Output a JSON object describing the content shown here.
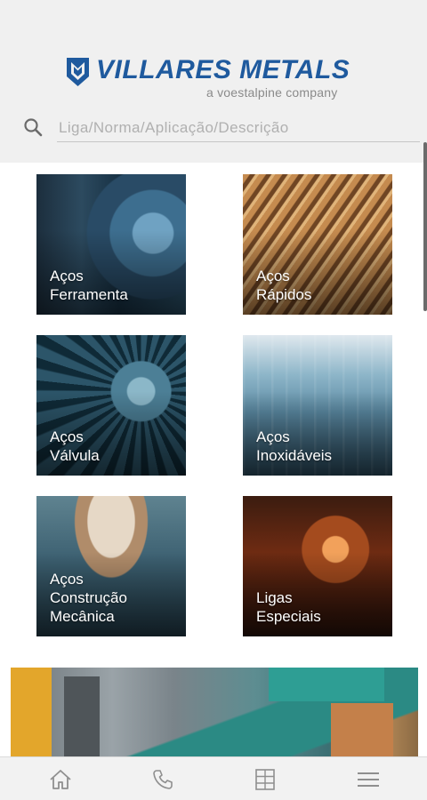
{
  "brand": {
    "name": "VILLARES METALS",
    "tagline": "a voestalpine company",
    "color": "#1f5a9e"
  },
  "search": {
    "placeholder": "Liga/Norma/Aplicação/Descrição",
    "value": "",
    "icon": "search-icon"
  },
  "categories": [
    {
      "id": "acos-ferramenta",
      "lines": [
        "Aços",
        "Ferramenta"
      ]
    },
    {
      "id": "acos-rapidos",
      "lines": [
        "Aços",
        "Rápidos"
      ]
    },
    {
      "id": "acos-valvula",
      "lines": [
        "Aços",
        "Válvula"
      ]
    },
    {
      "id": "acos-inoxidaveis",
      "lines": [
        "Aços",
        "Inoxidáveis"
      ]
    },
    {
      "id": "acos-construcao-mecanica",
      "lines": [
        "Aços",
        "Construção",
        "Mecânica"
      ]
    },
    {
      "id": "ligas-especiais",
      "lines": [
        "Ligas",
        "Especiais"
      ]
    }
  ],
  "bottom_nav": [
    {
      "id": "home",
      "icon": "home-icon"
    },
    {
      "id": "phone",
      "icon": "phone-icon"
    },
    {
      "id": "catalog",
      "icon": "catalog-icon"
    },
    {
      "id": "menu",
      "icon": "hamburger-menu-icon"
    }
  ]
}
